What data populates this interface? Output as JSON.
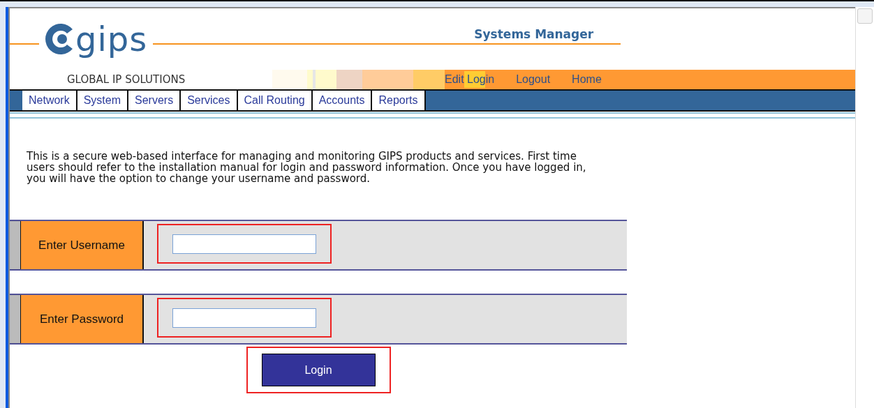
{
  "header": {
    "logo_text": "gips",
    "tagline": "GLOBAL IP SOLUTIONS",
    "title": "Systems Manager"
  },
  "top_links": [
    {
      "label": "Edit Login",
      "selected": true
    },
    {
      "label": "Logout",
      "selected": false
    },
    {
      "label": "Home",
      "selected": false
    }
  ],
  "nav_tabs": [
    "Network",
    "System",
    "Servers",
    "Services",
    "Call Routing",
    "Accounts",
    "Reports"
  ],
  "intro": "This is a secure web-based interface for managing and monitoring GIPS products and services. First time users should refer to the installation manual for login and password information. Once you have logged in, you will have the option to change your username and password.",
  "form": {
    "fields": [
      {
        "label": "Enter Username",
        "highlighted": true
      },
      {
        "label": "Enter Password",
        "highlighted": true
      }
    ],
    "submit": {
      "label": "Login",
      "highlighted": true
    }
  }
}
